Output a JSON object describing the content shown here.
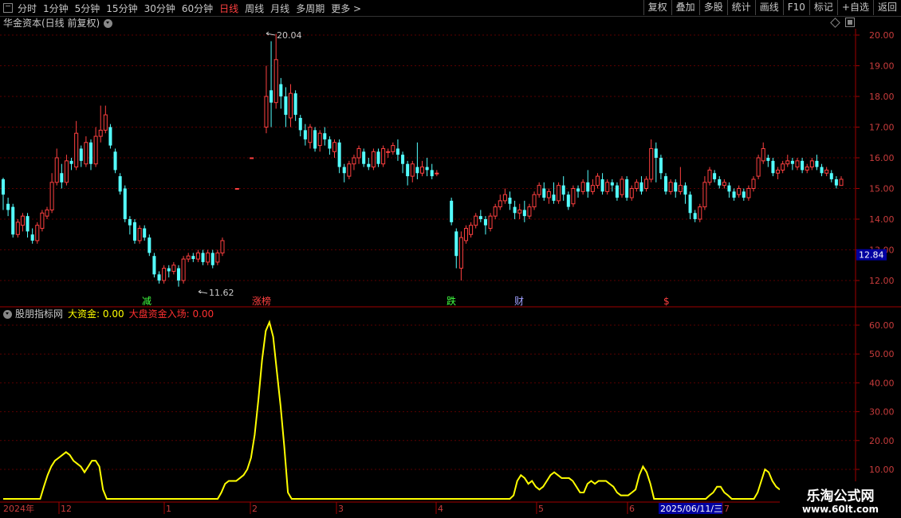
{
  "toolbar": {
    "periods": [
      {
        "label": "分时",
        "active": false
      },
      {
        "label": "1分钟",
        "active": false
      },
      {
        "label": "5分钟",
        "active": false
      },
      {
        "label": "15分钟",
        "active": false
      },
      {
        "label": "30分钟",
        "active": false
      },
      {
        "label": "60分钟",
        "active": false
      },
      {
        "label": "日线",
        "active": true
      },
      {
        "label": "周线",
        "active": false
      },
      {
        "label": "月线",
        "active": false
      },
      {
        "label": "多周期",
        "active": false
      },
      {
        "label": "更多 >",
        "active": false
      }
    ],
    "buttons": [
      "复权",
      "叠加",
      "多股",
      "统计",
      "画线",
      "F10",
      "标记",
      "+自选",
      "返回"
    ]
  },
  "title": "华金资本(日线 前复权)",
  "indicator": {
    "name": "股朋指标网",
    "label1": "大资金: 0.00",
    "label2": "大盘资金入场: 0.00"
  },
  "price_axis": [
    "20.00",
    "19.00",
    "18.00",
    "17.00",
    "16.00",
    "15.00",
    "14.00",
    "13.00",
    "12.00"
  ],
  "current_price": "12.84",
  "high_label": "20.04",
  "low_label": "11.62",
  "ind_axis": [
    "60.00",
    "50.00",
    "40.00",
    "30.00",
    "20.00",
    "10.00"
  ],
  "time_axis": [
    "2024年",
    "12",
    "1",
    "2",
    "3",
    "4",
    "5",
    "6",
    "7"
  ],
  "date_tag": "2025/06/11/三",
  "markers": [
    "减",
    "涨榜",
    "跌",
    "财",
    "$"
  ],
  "watermark": {
    "line1": "乐淘公式网",
    "line2": "www.60lt.com"
  },
  "colors": {
    "up": "#ff4040",
    "down": "#54ffff",
    "indicator": "#ffff00",
    "grid": "#5a0000",
    "axis": "#a00000"
  },
  "chart_data": {
    "type": "candlestick",
    "ylim": [
      11.5,
      20.4
    ],
    "candles": [
      [
        15.3,
        14.8,
        15.35,
        14.3
      ],
      [
        14.5,
        14.3,
        14.7,
        14.1
      ],
      [
        14.4,
        13.5,
        14.5,
        13.4
      ],
      [
        13.5,
        13.9,
        14.0,
        13.4
      ],
      [
        13.8,
        14.1,
        14.2,
        13.6
      ],
      [
        14.1,
        13.6,
        14.2,
        13.4
      ],
      [
        13.5,
        13.3,
        13.7,
        13.2
      ],
      [
        13.3,
        13.8,
        13.9,
        13.2
      ],
      [
        13.7,
        14.2,
        14.3,
        13.6
      ],
      [
        14.1,
        14.3,
        14.4,
        14.0
      ],
      [
        14.3,
        15.2,
        15.5,
        14.2
      ],
      [
        15.2,
        16.0,
        16.3,
        15.1
      ],
      [
        15.5,
        15.2,
        15.8,
        15.0
      ],
      [
        15.2,
        15.9,
        16.1,
        15.1
      ],
      [
        15.9,
        15.8,
        16.0,
        15.6
      ],
      [
        15.7,
        16.8,
        17.2,
        15.6
      ],
      [
        16.3,
        15.9,
        16.4,
        15.7
      ],
      [
        15.8,
        16.5,
        16.7,
        15.7
      ],
      [
        16.5,
        15.8,
        16.6,
        15.6
      ],
      [
        15.8,
        16.7,
        17.0,
        15.7
      ],
      [
        16.7,
        16.9,
        17.7,
        16.5
      ],
      [
        16.9,
        17.4,
        17.7,
        16.8
      ],
      [
        17.0,
        16.4,
        17.1,
        16.3
      ],
      [
        16.2,
        15.6,
        16.3,
        15.5
      ],
      [
        15.4,
        14.9,
        15.5,
        14.8
      ],
      [
        15.0,
        14.0,
        15.1,
        13.9
      ],
      [
        14.0,
        13.8,
        14.1,
        13.5
      ],
      [
        13.9,
        13.3,
        14.0,
        13.2
      ],
      [
        13.3,
        13.7,
        13.8,
        13.2
      ],
      [
        13.7,
        13.4,
        13.8,
        13.3
      ],
      [
        13.4,
        12.9,
        13.5,
        12.8
      ],
      [
        12.8,
        12.2,
        12.9,
        12.1
      ],
      [
        12.2,
        12.0,
        12.3,
        11.9
      ],
      [
        12.0,
        12.4,
        12.5,
        11.9
      ],
      [
        12.4,
        12.3,
        12.5,
        12.1
      ],
      [
        12.3,
        12.5,
        12.6,
        12.2
      ],
      [
        12.4,
        12.0,
        12.5,
        11.8
      ],
      [
        12.0,
        12.7,
        12.8,
        11.9
      ],
      [
        12.7,
        12.8,
        12.9,
        12.6
      ],
      [
        12.8,
        12.7,
        12.9,
        12.6
      ],
      [
        12.7,
        12.9,
        13.0,
        12.6
      ],
      [
        12.9,
        12.6,
        13.0,
        12.5
      ],
      [
        12.6,
        12.9,
        13.0,
        12.5
      ],
      [
        12.9,
        12.5,
        13.0,
        12.4
      ],
      [
        12.6,
        12.9,
        13.0,
        12.5
      ],
      [
        12.9,
        13.3,
        13.4,
        12.8
      ],
      null,
      null,
      [
        15.0,
        15.0,
        15.0,
        15.0
      ],
      null,
      null,
      [
        16.0,
        16.0,
        16.0,
        16.0
      ],
      null,
      null,
      [
        17.0,
        18.0,
        19.0,
        16.8
      ],
      [
        18.2,
        17.8,
        19.8,
        17.0
      ],
      [
        17.8,
        19.2,
        20.04,
        17.6
      ],
      [
        18.4,
        18.0,
        18.6,
        17.6
      ],
      [
        18.0,
        17.4,
        18.3,
        17.0
      ],
      [
        17.3,
        18.1,
        18.4,
        17.0
      ],
      [
        18.1,
        17.4,
        18.2,
        17.2
      ],
      [
        17.3,
        16.9,
        17.4,
        16.7
      ],
      [
        16.9,
        16.6,
        17.1,
        16.4
      ],
      [
        16.5,
        17.0,
        17.1,
        16.3
      ],
      [
        16.9,
        16.3,
        17.0,
        16.2
      ],
      [
        16.4,
        16.8,
        16.9,
        16.2
      ],
      [
        16.8,
        16.6,
        17.0,
        16.4
      ],
      [
        16.6,
        16.3,
        16.7,
        16.1
      ],
      [
        16.2,
        16.5,
        16.6,
        16.0
      ],
      [
        16.5,
        15.7,
        16.6,
        15.5
      ],
      [
        15.7,
        15.5,
        15.8,
        15.2
      ],
      [
        15.4,
        15.8,
        15.9,
        15.3
      ],
      [
        15.8,
        16.0,
        16.1,
        15.6
      ],
      [
        16.0,
        16.3,
        16.4,
        15.8
      ],
      [
        16.2,
        15.8,
        16.3,
        15.7
      ],
      [
        15.8,
        15.7,
        16.0,
        15.6
      ],
      [
        15.7,
        16.2,
        16.3,
        15.6
      ],
      [
        16.2,
        15.8,
        16.3,
        15.7
      ],
      [
        15.8,
        16.3,
        16.4,
        15.7
      ],
      [
        16.2,
        16.2,
        16.3,
        16.0
      ],
      [
        16.2,
        16.4,
        16.5,
        16.1
      ],
      [
        16.3,
        16.1,
        16.6,
        15.9
      ],
      [
        16.1,
        15.8,
        16.2,
        15.5
      ],
      [
        15.8,
        15.4,
        15.9,
        15.1
      ],
      [
        15.4,
        15.8,
        15.9,
        15.2
      ],
      [
        15.7,
        15.5,
        16.5,
        15.3
      ],
      [
        15.5,
        15.7,
        15.9,
        15.4
      ],
      [
        15.7,
        15.6,
        16.0,
        15.4
      ],
      [
        15.6,
        15.4,
        15.8,
        15.3
      ],
      [
        15.5,
        15.5,
        15.6,
        15.4
      ],
      null,
      null,
      [
        14.6,
        13.9,
        14.7,
        13.8
      ],
      [
        13.6,
        12.8,
        13.7,
        12.4
      ],
      [
        12.4,
        13.4,
        13.6,
        12.0
      ],
      [
        13.3,
        13.7,
        13.8,
        13.2
      ],
      [
        13.5,
        13.8,
        13.9,
        13.4
      ],
      [
        13.8,
        14.1,
        14.2,
        13.7
      ],
      [
        14.1,
        14.0,
        14.3,
        13.9
      ],
      [
        14.0,
        13.8,
        14.1,
        13.5
      ],
      [
        13.7,
        14.1,
        14.2,
        13.6
      ],
      [
        14.1,
        14.4,
        14.5,
        14.0
      ],
      [
        14.4,
        14.6,
        14.8,
        14.3
      ],
      [
        14.6,
        14.8,
        15.0,
        14.5
      ],
      [
        14.7,
        14.5,
        14.9,
        14.3
      ],
      [
        14.4,
        14.2,
        14.6,
        14.0
      ],
      [
        14.2,
        14.3,
        14.5,
        14.0
      ],
      [
        14.3,
        14.1,
        14.6,
        13.9
      ],
      [
        14.1,
        14.4,
        14.5,
        14.0
      ],
      [
        14.4,
        14.8,
        14.9,
        14.3
      ],
      [
        14.8,
        15.1,
        15.2,
        14.7
      ],
      [
        15.0,
        14.7,
        15.2,
        14.6
      ],
      [
        14.7,
        14.9,
        15.0,
        14.5
      ],
      [
        14.8,
        14.6,
        15.2,
        14.5
      ],
      [
        14.6,
        15.1,
        15.2,
        14.5
      ],
      [
        15.1,
        14.8,
        15.4,
        14.6
      ],
      [
        14.8,
        14.4,
        14.9,
        14.3
      ],
      [
        14.5,
        15.0,
        15.1,
        14.4
      ],
      [
        15.0,
        14.9,
        15.1,
        14.7
      ],
      [
        14.9,
        15.2,
        15.3,
        14.8
      ],
      [
        15.2,
        14.9,
        15.6,
        14.7
      ],
      [
        14.9,
        15.1,
        15.3,
        14.8
      ],
      [
        15.1,
        15.4,
        15.5,
        15.0
      ],
      [
        15.3,
        14.9,
        15.5,
        14.8
      ],
      [
        14.9,
        15.2,
        15.3,
        14.8
      ],
      [
        15.2,
        15.1,
        15.3,
        14.9
      ],
      [
        15.1,
        14.7,
        15.2,
        14.6
      ],
      [
        14.8,
        15.3,
        15.4,
        14.7
      ],
      [
        15.3,
        14.7,
        15.4,
        14.6
      ],
      [
        14.7,
        15.0,
        15.1,
        14.6
      ],
      [
        15.0,
        15.2,
        15.3,
        14.9
      ],
      [
        15.2,
        14.9,
        15.4,
        14.8
      ],
      [
        15.0,
        15.3,
        15.4,
        14.9
      ],
      [
        15.3,
        16.3,
        16.6,
        15.2
      ],
      [
        16.3,
        16.0,
        16.5,
        15.2
      ],
      [
        16.0,
        15.5,
        16.1,
        15.3
      ],
      [
        15.4,
        14.9,
        15.5,
        14.8
      ],
      [
        14.9,
        15.2,
        15.3,
        14.8
      ],
      [
        15.2,
        14.9,
        15.3,
        14.7
      ],
      [
        14.9,
        15.1,
        15.7,
        14.8
      ],
      [
        15.1,
        14.8,
        15.2,
        14.5
      ],
      [
        14.8,
        14.2,
        14.9,
        14.0
      ],
      [
        14.2,
        14.0,
        14.3,
        13.9
      ],
      [
        14.0,
        14.4,
        14.5,
        13.9
      ],
      [
        14.4,
        15.2,
        15.4,
        14.3
      ],
      [
        15.2,
        15.6,
        15.7,
        15.1
      ],
      [
        15.5,
        15.3,
        15.6,
        15.2
      ],
      [
        15.3,
        15.1,
        15.4,
        15.0
      ],
      [
        15.1,
        15.2,
        15.3,
        15.0
      ],
      [
        15.1,
        14.9,
        15.2,
        14.7
      ],
      [
        14.9,
        14.7,
        15.0,
        14.6
      ],
      [
        14.8,
        15.0,
        15.1,
        14.7
      ],
      [
        14.9,
        14.7,
        15.0,
        14.6
      ],
      [
        14.7,
        15.0,
        15.1,
        14.6
      ],
      [
        15.0,
        15.3,
        15.4,
        14.9
      ],
      [
        15.4,
        16.0,
        16.1,
        15.3
      ],
      [
        15.9,
        16.3,
        16.5,
        15.8
      ],
      [
        16.0,
        15.9,
        16.1,
        15.7
      ],
      [
        15.9,
        15.5,
        16.0,
        15.4
      ],
      [
        15.5,
        15.6,
        15.7,
        15.3
      ],
      [
        15.6,
        15.8,
        15.9,
        15.5
      ],
      [
        15.8,
        15.9,
        16.1,
        15.7
      ],
      [
        15.9,
        15.8,
        16.0,
        15.6
      ],
      [
        15.7,
        15.9,
        16.0,
        15.6
      ],
      [
        15.9,
        15.6,
        16.0,
        15.5
      ],
      [
        15.6,
        15.7,
        15.8,
        15.5
      ],
      [
        15.7,
        15.9,
        16.0,
        15.6
      ],
      [
        15.9,
        15.7,
        16.1,
        15.6
      ],
      [
        15.7,
        15.5,
        15.8,
        15.4
      ],
      [
        15.5,
        15.6,
        15.7,
        15.4
      ],
      [
        15.5,
        15.3,
        15.6,
        15.2
      ],
      [
        15.3,
        15.1,
        15.4,
        15.0
      ],
      [
        15.1,
        15.3,
        15.4,
        15.1
      ]
    ],
    "indicator_values": [
      0,
      0,
      0,
      0,
      0,
      0,
      0,
      0,
      0,
      0,
      0,
      4,
      8,
      11,
      13,
      14,
      15,
      16,
      15,
      13,
      12,
      11,
      9,
      11,
      13,
      13,
      11,
      3,
      0,
      0,
      0,
      0,
      0,
      0,
      0,
      0,
      0,
      0,
      0,
      0,
      0,
      0,
      0,
      0,
      0,
      0,
      0,
      0,
      0,
      0,
      0,
      0,
      0,
      0,
      0,
      0,
      0,
      0,
      0,
      2,
      5,
      6,
      6,
      6,
      7,
      8,
      10,
      14,
      22,
      34,
      48,
      58,
      61,
      56,
      44,
      32,
      18,
      2,
      0,
      0,
      0,
      0,
      0,
      0,
      0,
      0,
      0,
      0,
      0,
      0,
      0,
      0,
      0,
      0,
      0,
      0,
      0,
      0,
      0,
      0,
      0,
      0,
      0,
      0,
      0,
      0,
      0,
      0,
      0,
      0,
      0,
      0,
      0,
      0,
      0,
      0,
      0,
      0,
      0,
      0,
      0,
      0,
      0,
      0,
      0,
      0,
      0,
      0,
      0,
      0,
      0,
      0,
      0,
      0,
      0,
      0,
      0,
      0,
      1,
      6,
      8,
      7,
      5,
      6,
      4,
      3,
      4,
      6,
      8,
      9,
      8,
      7,
      7,
      7,
      6,
      4,
      2,
      2,
      5,
      6,
      5,
      6,
      6,
      6,
      5,
      4,
      2,
      1,
      1,
      1,
      2,
      3,
      8,
      11,
      9,
      5,
      0,
      0,
      0,
      0,
      0,
      0,
      0,
      0,
      0,
      0,
      0,
      0,
      0,
      0,
      0,
      1,
      2,
      4,
      4,
      2,
      1,
      0,
      0,
      0,
      0,
      0,
      0,
      0,
      2,
      6,
      10,
      9,
      6,
      4,
      3
    ]
  }
}
